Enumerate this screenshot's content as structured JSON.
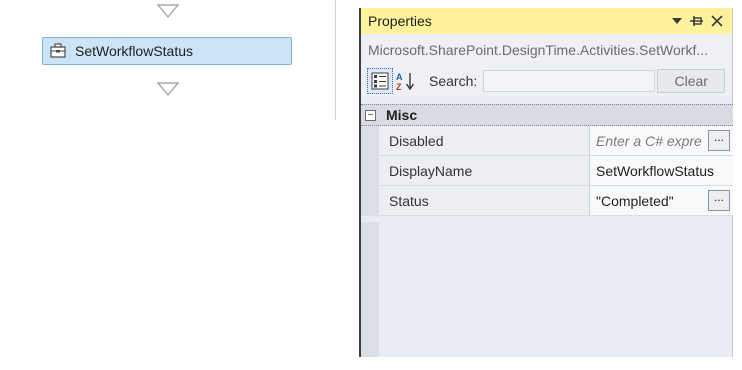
{
  "designer": {
    "activity": {
      "label": "SetWorkflowStatus"
    }
  },
  "properties": {
    "title": "Properties",
    "object_type": "Microsoft.SharePoint.DesignTime.Activities.SetWorkf...",
    "search": {
      "label": "Search:",
      "value": "",
      "clear_label": "Clear"
    },
    "category": {
      "name": "Misc",
      "expander": "−"
    },
    "rows": [
      {
        "name": "Disabled",
        "value": "",
        "placeholder": "Enter a C# expre",
        "has_ellipsis": true
      },
      {
        "name": "DisplayName",
        "value": "SetWorkflowStatus",
        "has_ellipsis": false
      },
      {
        "name": "Status",
        "value": "\"Completed\"",
        "has_ellipsis": true
      }
    ],
    "ellipsis_label": "..."
  },
  "colors": {
    "title_bar": "#fff29d",
    "activity_selected_bg": "#cce4f7",
    "activity_selected_border": "#7fb1df",
    "pane_bg": "#e9ecf3"
  },
  "icons": {
    "title_buttons": [
      "dropdown-icon",
      "pin-icon",
      "close-icon"
    ],
    "toolbar": [
      "categorized-icon",
      "sort-alpha-icon"
    ],
    "activity": "set-status-icon",
    "connectors": "drop-arrow-icon"
  }
}
